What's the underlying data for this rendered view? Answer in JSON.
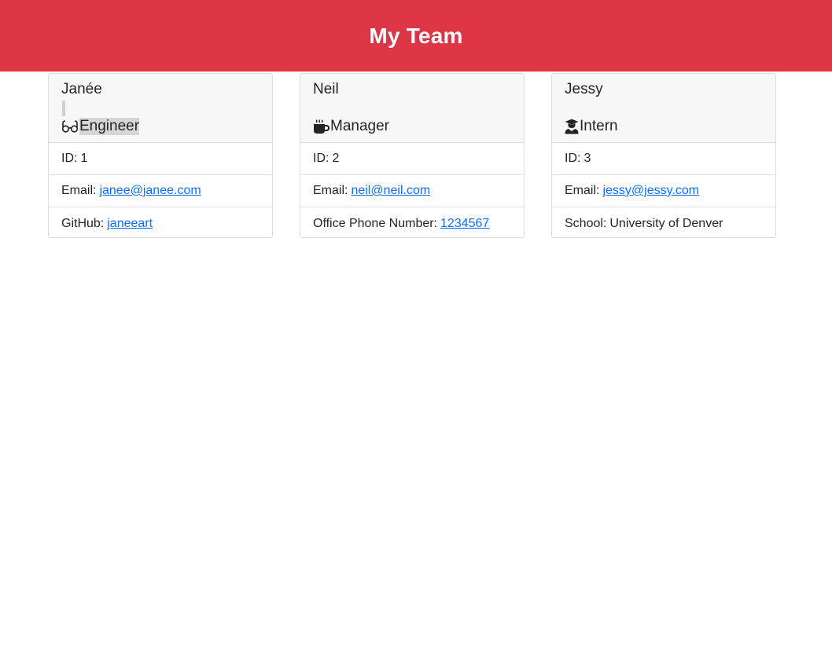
{
  "header": {
    "title": "My Team"
  },
  "colors": {
    "header_bg": "#dc3545",
    "link": "#0d6efd"
  },
  "cards": [
    {
      "name": "Janée",
      "role": "Engineer",
      "icon": "glasses-icon",
      "id_label": "ID:",
      "id_value": "1",
      "email_label": "Email:",
      "email_value": "janee@janee.com",
      "extra_label": "GitHub:",
      "extra_value": "janeeart"
    },
    {
      "name": "Neil",
      "role": "Manager",
      "icon": "mug-icon",
      "id_label": "ID:",
      "id_value": "2",
      "email_label": "Email:",
      "email_value": "neil@neil.com",
      "extra_label": "Office Phone Number:",
      "extra_value": "1234567"
    },
    {
      "name": "Jessy",
      "role": "Intern",
      "icon": "graduate-icon",
      "id_label": "ID:",
      "id_value": "3",
      "email_label": "Email:",
      "email_value": "jessy@jessy.com",
      "extra_label": "School:",
      "extra_value": "University of Denver"
    }
  ]
}
